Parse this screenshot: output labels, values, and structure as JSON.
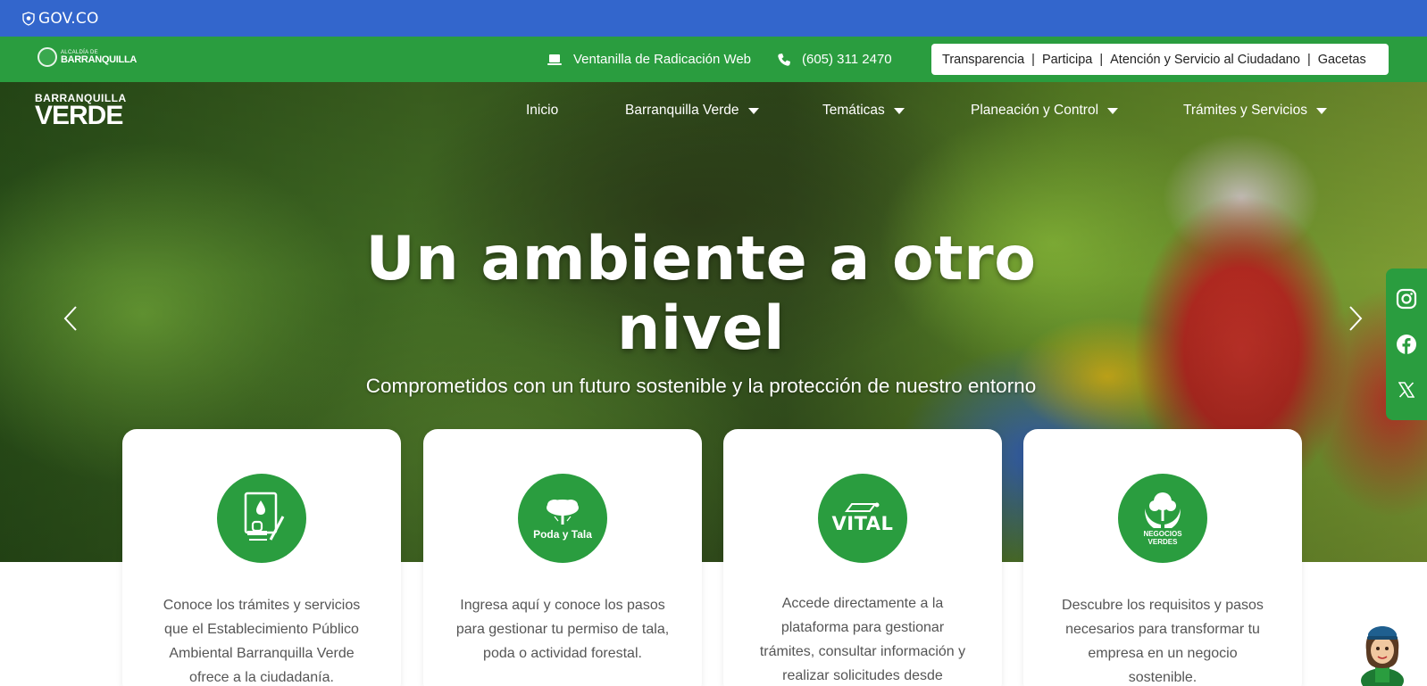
{
  "gov_bar": {
    "label": "GOV.CO",
    "color": "#3366cc"
  },
  "utility_bar": {
    "alcaldia_small": "ALCALDÍA DE",
    "alcaldia_big": "BARRANQUILLA",
    "ventanilla": "Ventanilla de Radicación Web",
    "phone": "(605) 311 2470",
    "links": [
      "Transparencia",
      "Participa",
      "Atención y Servicio al Ciudadano",
      "Gacetas"
    ],
    "color": "#2a9d3f"
  },
  "logo": {
    "line1": "BARRANQUILLA",
    "line2": "VERDE"
  },
  "nav": {
    "items": [
      {
        "label": "Inicio"
      },
      {
        "label": "Barranquilla Verde"
      },
      {
        "label": "Temáticas"
      },
      {
        "label": "Planeación y Control"
      },
      {
        "label": "Trámites y Servicios"
      }
    ]
  },
  "hero": {
    "title": "Un ambiente a otro nivel",
    "subtitle": "Comprometidos con un futuro sostenible y la protección de nuestro entorno"
  },
  "social": {
    "icons": [
      "instagram-icon",
      "facebook-icon",
      "x-icon"
    ]
  },
  "cards": [
    {
      "badge_text": "",
      "icon": "document-stamp-icon",
      "desc": "Conoce los trámites y servicios que el Establecimiento Público Ambiental Barranquilla Verde ofrece a la ciudadanía."
    },
    {
      "badge_text": "Poda y Tala",
      "icon": "tree-icon",
      "desc": "Ingresa aquí y conoce los pasos para gestionar tu permiso de tala, poda o actividad forestal."
    },
    {
      "badge_text": "VITAL",
      "icon": "vital-logo-icon",
      "desc": "Accede directamente a la plataforma para gestionar trámites, consultar información y realizar solicitudes desde"
    },
    {
      "badge_text": "NEGOCIOS VERDES",
      "icon": "hands-tree-icon",
      "desc": "Descubre los requisitos y pasos necesarios para transformar tu empresa en un negocio sostenible."
    }
  ]
}
